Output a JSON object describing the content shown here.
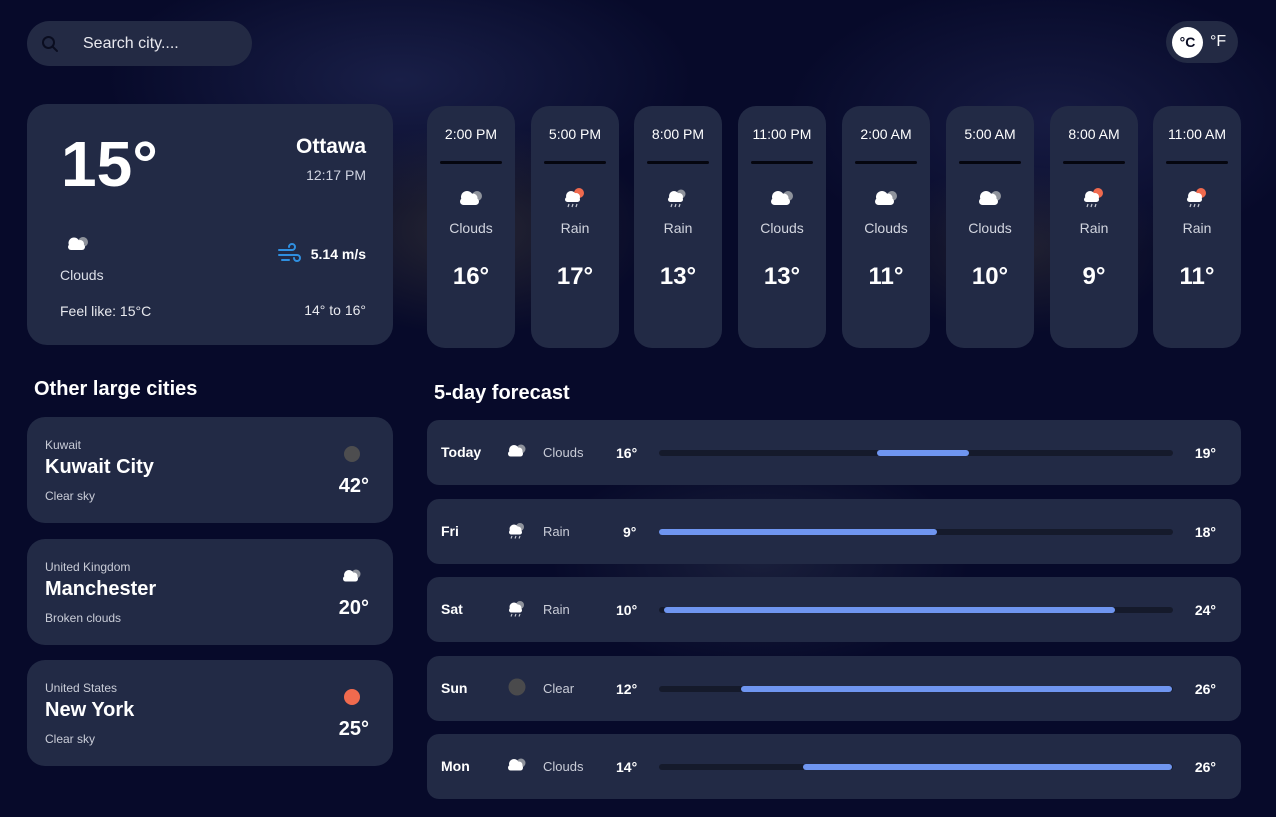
{
  "search": {
    "placeholder": "Search city...."
  },
  "units": {
    "celsius": "°C",
    "fahrenheit": "°F"
  },
  "current": {
    "temp": "15°",
    "city": "Ottawa",
    "time": "12:17 PM",
    "condition": "Clouds",
    "icon": "clouds-icon",
    "wind": "5.14 m/s",
    "feels_like": "Feel like: 15°C",
    "range": "14° to 16°"
  },
  "hourly": [
    {
      "time": "2:00 PM",
      "condition": "Clouds",
      "temp": "16°",
      "icon": "clouds-icon"
    },
    {
      "time": "5:00 PM",
      "condition": "Rain",
      "temp": "17°",
      "icon": "rain-sun-icon"
    },
    {
      "time": "8:00 PM",
      "condition": "Rain",
      "temp": "13°",
      "icon": "rain-icon"
    },
    {
      "time": "11:00 PM",
      "condition": "Clouds",
      "temp": "13°",
      "icon": "clouds-icon"
    },
    {
      "time": "2:00 AM",
      "condition": "Clouds",
      "temp": "11°",
      "icon": "clouds-icon"
    },
    {
      "time": "5:00 AM",
      "condition": "Clouds",
      "temp": "10°",
      "icon": "clouds-icon"
    },
    {
      "time": "8:00 AM",
      "condition": "Rain",
      "temp": "9°",
      "icon": "rain-sun-icon"
    },
    {
      "time": "11:00 AM",
      "condition": "Rain",
      "temp": "11°",
      "icon": "rain-sun-icon"
    }
  ],
  "other_cities": {
    "heading": "Other large cities",
    "items": [
      {
        "country": "Kuwait",
        "city": "Kuwait City",
        "description": "Clear sky",
        "temp": "42°",
        "icon": "clear-night-icon"
      },
      {
        "country": "United Kingdom",
        "city": "Manchester",
        "description": "Broken clouds",
        "temp": "20°",
        "icon": "clouds-icon"
      },
      {
        "country": "United States",
        "city": "New York",
        "description": "Clear sky",
        "temp": "25°",
        "icon": "sun-icon"
      }
    ]
  },
  "forecast": {
    "heading": "5-day forecast",
    "items": [
      {
        "day": "Today",
        "condition": "Clouds",
        "min": "16°",
        "max": "19°",
        "icon": "clouds-icon",
        "bar_start": 0.424,
        "bar_end": 0.603
      },
      {
        "day": "Fri",
        "condition": "Rain",
        "min": "9°",
        "max": "18°",
        "icon": "rain-icon",
        "bar_start": 0.0,
        "bar_end": 0.541
      },
      {
        "day": "Sat",
        "condition": "Rain",
        "min": "10°",
        "max": "24°",
        "icon": "rain-icon",
        "bar_start": 0.01,
        "bar_end": 0.887
      },
      {
        "day": "Sun",
        "condition": "Clear",
        "min": "12°",
        "max": "26°",
        "icon": "clear-night-icon",
        "bar_start": 0.159,
        "bar_end": 0.998
      },
      {
        "day": "Mon",
        "condition": "Clouds",
        "min": "14°",
        "max": "26°",
        "icon": "clouds-icon",
        "bar_start": 0.28,
        "bar_end": 0.998
      }
    ]
  },
  "colors": {
    "background": "#070a2a",
    "card": "#222a45",
    "bar_fill": "#6f95f0",
    "bar_track": "#151a2b",
    "sun": "#f06a4e",
    "wind_icon": "#2f8fe0"
  }
}
